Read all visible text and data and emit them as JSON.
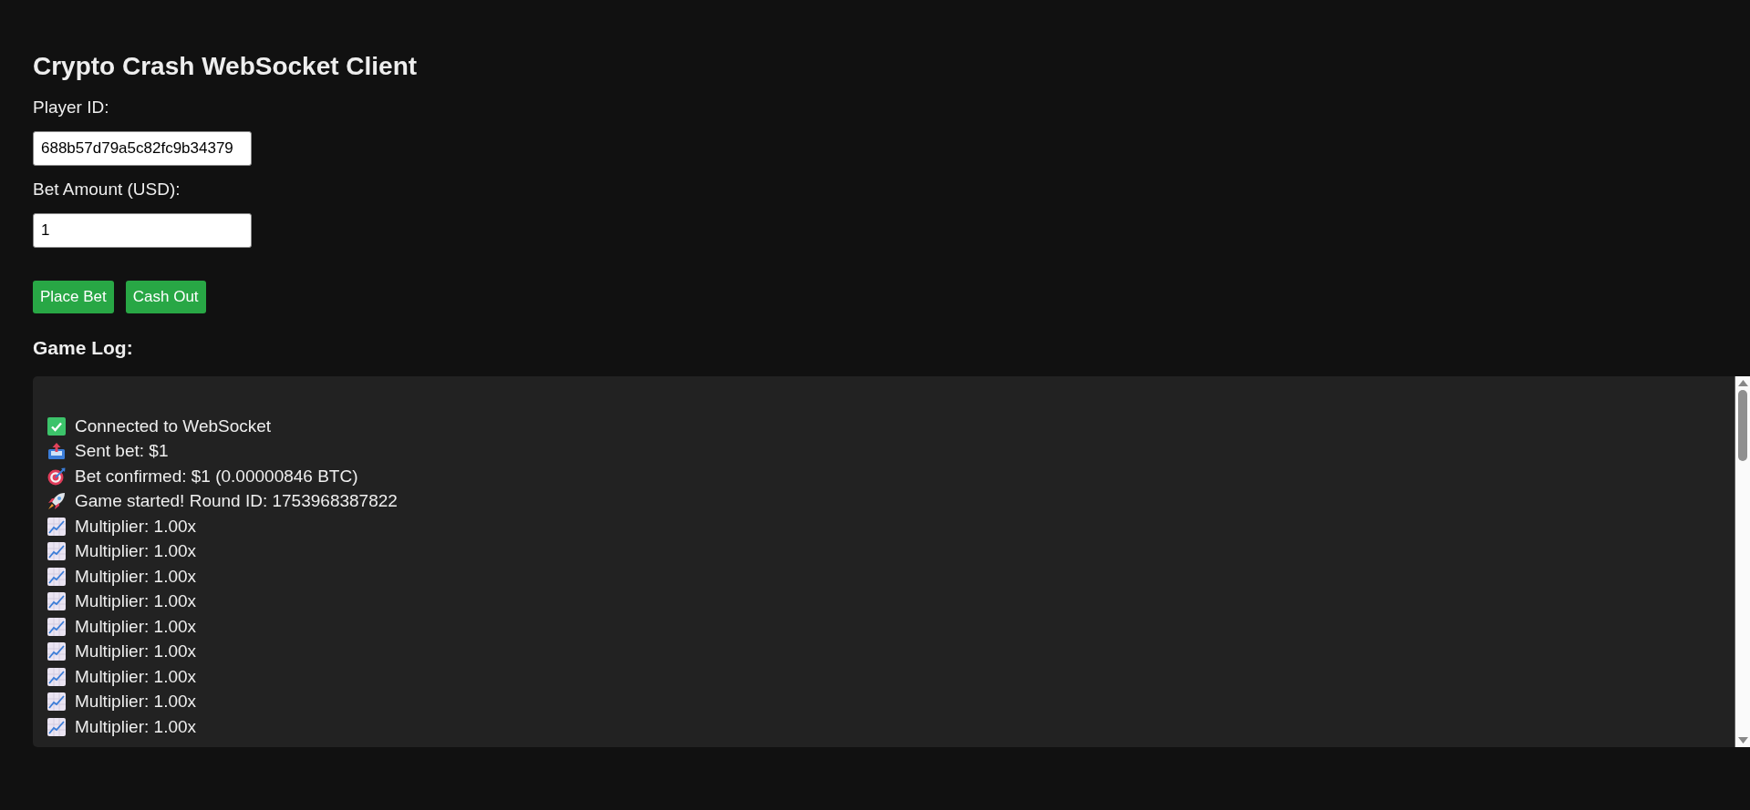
{
  "title": "Crypto Crash WebSocket Client",
  "fields": [
    {
      "label": "Player ID:",
      "value": "688b57d79a5c82fc9b34379"
    },
    {
      "label": "Bet Amount (USD):",
      "value": "1"
    }
  ],
  "buttons": [
    "Place Bet",
    "Cash Out"
  ],
  "log": {
    "heading": "Game Log:",
    "entries": [
      {
        "kind": "connected",
        "text": "Connected to WebSocket"
      },
      {
        "kind": "sent",
        "text": "Sent bet: $1"
      },
      {
        "kind": "confirmed",
        "text": "Bet confirmed: $1 (0.00000846 BTC)"
      },
      {
        "kind": "started",
        "text": "Game started! Round ID: 1753968387822"
      },
      {
        "kind": "multiplier",
        "text": "Multiplier: 1.00x"
      },
      {
        "kind": "multiplier",
        "text": "Multiplier: 1.00x"
      },
      {
        "kind": "multiplier",
        "text": "Multiplier: 1.00x"
      },
      {
        "kind": "multiplier",
        "text": "Multiplier: 1.00x"
      },
      {
        "kind": "multiplier",
        "text": "Multiplier: 1.00x"
      },
      {
        "kind": "multiplier",
        "text": "Multiplier: 1.00x"
      },
      {
        "kind": "multiplier",
        "text": "Multiplier: 1.00x"
      },
      {
        "kind": "multiplier",
        "text": "Multiplier: 1.00x"
      },
      {
        "kind": "multiplier",
        "text": "Multiplier: 1.00x"
      }
    ]
  }
}
